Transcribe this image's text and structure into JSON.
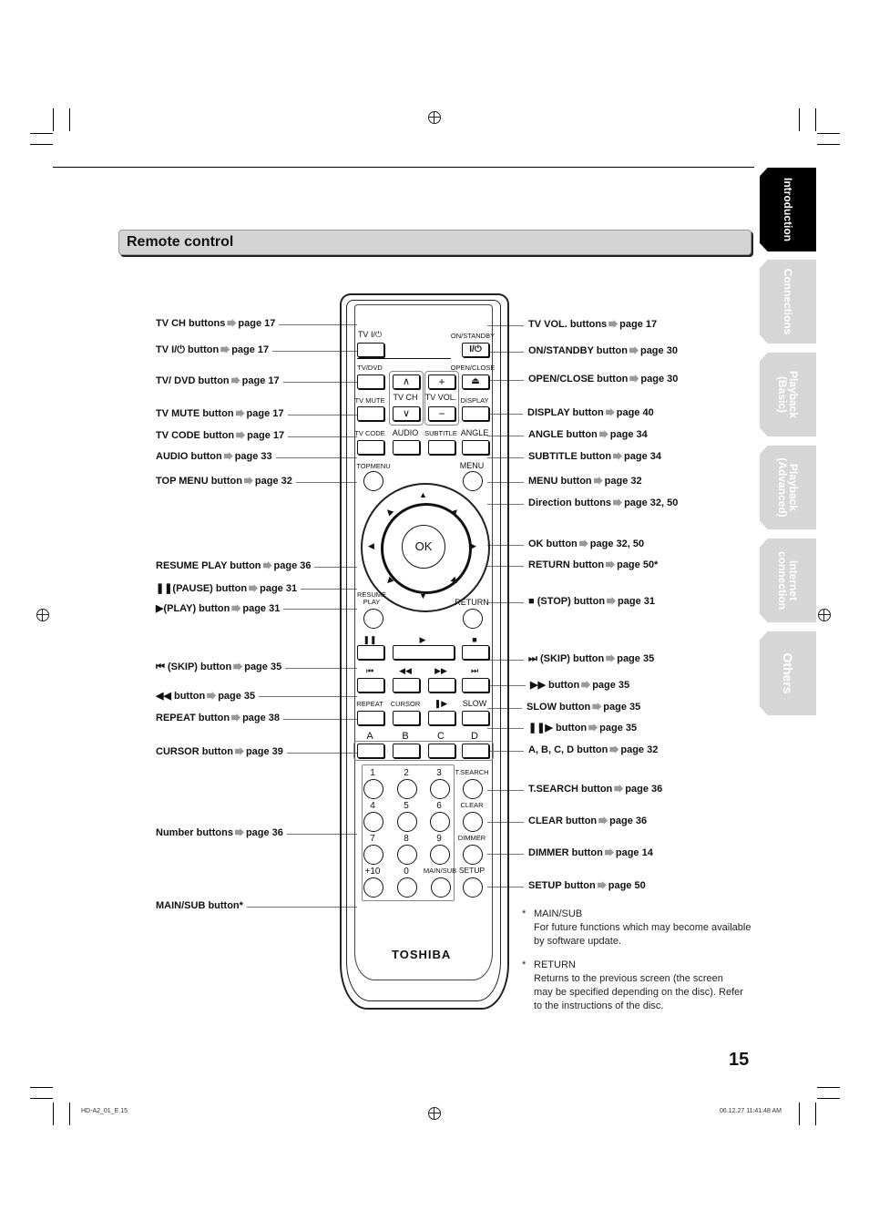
{
  "section_title": "Remote control",
  "page_number": "15",
  "footer": {
    "left": "HD-A2_01_E  15",
    "right": "06.12.27  11:41:48 AM"
  },
  "tabs": [
    {
      "label": "Introduction",
      "active": true
    },
    {
      "label": "Connections",
      "active": false
    },
    {
      "label": "Playback\n(Basic)",
      "active": false
    },
    {
      "label": "Playback\n(Advanced)",
      "active": false
    },
    {
      "label": "Internet\nconnection",
      "active": false
    },
    {
      "label": "Others",
      "active": false
    }
  ],
  "left_labels": [
    {
      "name": "TV CH buttons",
      "page": "page 17"
    },
    {
      "name": "TV I/⏻ button",
      "page": "page 17"
    },
    {
      "name": "TV/ DVD button",
      "page": "page 17"
    },
    {
      "name": "TV MUTE button",
      "page": "page 17"
    },
    {
      "name": "TV CODE button",
      "page": "page 17"
    },
    {
      "name": "AUDIO button",
      "page": "page 33"
    },
    {
      "name": "TOP MENU button",
      "page": "page 32"
    },
    {
      "name": "RESUME PLAY button",
      "page": "page 36"
    },
    {
      "name": "❚❚(PAUSE) button",
      "page": "page 31"
    },
    {
      "name": "▶(PLAY) button",
      "page": "page 31"
    },
    {
      "name": "⏮ (SKIP) button",
      "page": "page 35"
    },
    {
      "name": "◀◀ button",
      "page": "page 35"
    },
    {
      "name": "REPEAT button",
      "page": "page 38"
    },
    {
      "name": "CURSOR button",
      "page": "page 39"
    },
    {
      "name": "Number buttons",
      "page": "page 36"
    },
    {
      "name": "MAIN/SUB button*",
      "page": ""
    }
  ],
  "right_labels": [
    {
      "name": "TV VOL. buttons",
      "page": "page 17"
    },
    {
      "name": "ON/STANDBY button",
      "page": "page 30"
    },
    {
      "name": "OPEN/CLOSE button",
      "page": "page 30"
    },
    {
      "name": "DISPLAY button",
      "page": "page 40"
    },
    {
      "name": "ANGLE button",
      "page": "page 34"
    },
    {
      "name": "SUBTITLE button",
      "page": "page 34"
    },
    {
      "name": "MENU button",
      "page": "page 32"
    },
    {
      "name": "Direction buttons",
      "page": "page 32, 50"
    },
    {
      "name": "OK button",
      "page": "page 32, 50"
    },
    {
      "name": "RETURN button",
      "page": "page 50*"
    },
    {
      "name": "■ (STOP) button",
      "page": "page 31"
    },
    {
      "name": "⏭ (SKIP) button",
      "page": "page 35"
    },
    {
      "name": "▶▶ button",
      "page": "page 35"
    },
    {
      "name": "SLOW button",
      "page": "page 35"
    },
    {
      "name": "❚❚▶ button",
      "page": "page 35"
    },
    {
      "name": "A, B, C, D button",
      "page": "page 32"
    },
    {
      "name": "T.SEARCH button",
      "page": "page 36"
    },
    {
      "name": "CLEAR button",
      "page": "page 36"
    },
    {
      "name": "DIMMER button",
      "page": "page 14"
    },
    {
      "name": "SETUP button",
      "page": "page 50"
    }
  ],
  "notes": [
    {
      "marker": "*",
      "title": "MAIN/SUB",
      "text": "For future functions which may become available by software update."
    },
    {
      "marker": "*",
      "title": "RETURN",
      "text": "Returns to the previous screen (the screen may be specified depending on the disc). Refer to the instructions of the disc."
    }
  ],
  "remote": {
    "brand": "TOSHIBA",
    "labels": {
      "tv_power": "TV  I/⏻",
      "on_standby": "ON/STANDBY",
      "on_standby_glyph": "I/⏻",
      "tv_dvd": "TV/DVD",
      "open_close": "OPEN/CLOSE",
      "eject_glyph": "⏏",
      "tv_ch": "TV CH",
      "tv_vol": "TV VOL.",
      "ch_up": "∧",
      "ch_down": "∨",
      "vol_up": "+",
      "vol_down": "−",
      "tv_mute": "TV MUTE",
      "display": "DISPLAY",
      "tv_code": "TV CODE",
      "audio": "AUDIO",
      "subtitle": "SUBTITLE",
      "angle": "ANGLE",
      "top_menu": "TOPMENU",
      "menu": "MENU",
      "ok": "OK",
      "resume_play": "RESUME\nPLAY",
      "return": "RETURN",
      "pause": "❚❚",
      "play": "▶",
      "stop": "■",
      "skip_back": "⏮",
      "rewind": "◀◀",
      "ffwd": "▶▶",
      "skip_fwd": "⏭",
      "repeat": "REPEAT",
      "cursor": "CURSOR",
      "slow_fwd": "❚▶",
      "slow": "SLOW",
      "a": "A",
      "b": "B",
      "c": "C",
      "d": "D",
      "numbers": [
        "1",
        "2",
        "3",
        "4",
        "5",
        "6",
        "7",
        "8",
        "9",
        "+10",
        "0"
      ],
      "t_search": "T.SEARCH",
      "clear": "CLEAR",
      "dimmer": "DIMMER",
      "main_sub": "MAIN/SUB",
      "setup": "SETUP"
    }
  }
}
